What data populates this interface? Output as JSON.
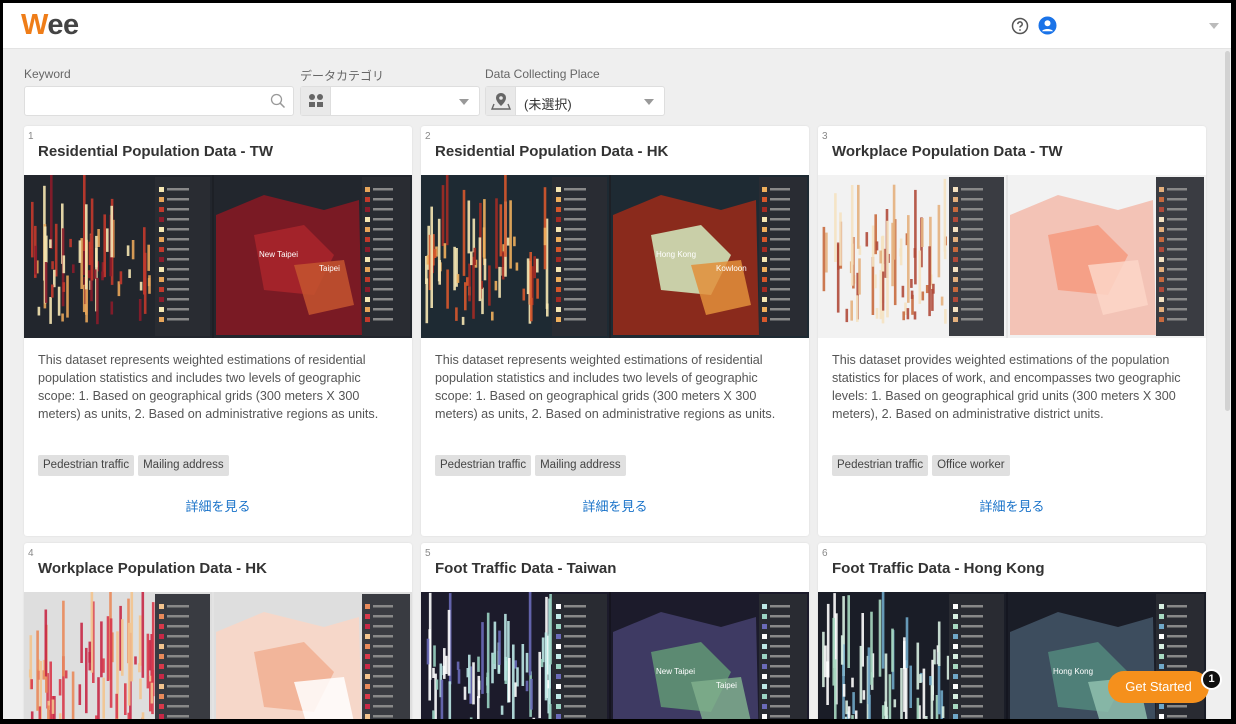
{
  "header": {
    "logo_first": "W",
    "logo_rest": "ee"
  },
  "filters": {
    "keyword_label": "Keyword",
    "keyword_value": "",
    "category_label": "データカテゴリ",
    "category_value": "",
    "place_label": "Data Collecting Place",
    "place_value": "(未選択)"
  },
  "cards": [
    {
      "num": "1",
      "title": "Residential Population Data - TW",
      "desc": "This dataset represents weighted estimations of residential population statistics and includes two levels of geographic scope: 1. Based on geographical grids (300 meters X 300 meters) as units, 2. Based on administrative regions as units.",
      "tags": [
        "Pedestrian traffic",
        "Mailing address"
      ],
      "detail": "詳細を見る",
      "theme": "red",
      "map_label_a": "New Taipei",
      "map_label_b": "Taipei"
    },
    {
      "num": "2",
      "title": "Residential Population Data - HK",
      "desc": "This dataset represents weighted estimations of residential population statistics and includes two levels of geographic scope: 1. Based on geographical grids (300 meters X 300 meters) as units, 2. Based on administrative regions as units.",
      "tags": [
        "Pedestrian traffic",
        "Mailing address"
      ],
      "detail": "詳細を見る",
      "theme": "hk",
      "map_label_a": "Hong Kong",
      "map_label_b": "Kowloon"
    },
    {
      "num": "3",
      "title": "Workplace Population Data - TW",
      "desc": "This dataset provides weighted estimations of the population statistics for places of work, and encompasses two geographic levels: 1. Based on geographical grid units (300 meters X 300 meters), 2. Based on administrative district units.",
      "tags": [
        "Pedestrian traffic",
        "Office worker"
      ],
      "detail": "詳細を見る",
      "theme": "light",
      "map_label_a": "",
      "map_label_b": ""
    },
    {
      "num": "4",
      "title": "Workplace Population Data - HK",
      "desc": "",
      "tags": [],
      "detail": "",
      "theme": "light-hk",
      "map_label_a": "",
      "map_label_b": ""
    },
    {
      "num": "5",
      "title": "Foot Traffic Data - Taiwan",
      "desc": "",
      "tags": [],
      "detail": "",
      "theme": "dark",
      "map_label_a": "New Taipei",
      "map_label_b": "Taipei"
    },
    {
      "num": "6",
      "title": "Foot Traffic Data - Hong Kong",
      "desc": "",
      "tags": [],
      "detail": "",
      "theme": "dark-hk",
      "map_label_a": "Hong Kong",
      "map_label_b": ""
    }
  ],
  "cta": {
    "label": "Get Started",
    "badge": "1"
  }
}
